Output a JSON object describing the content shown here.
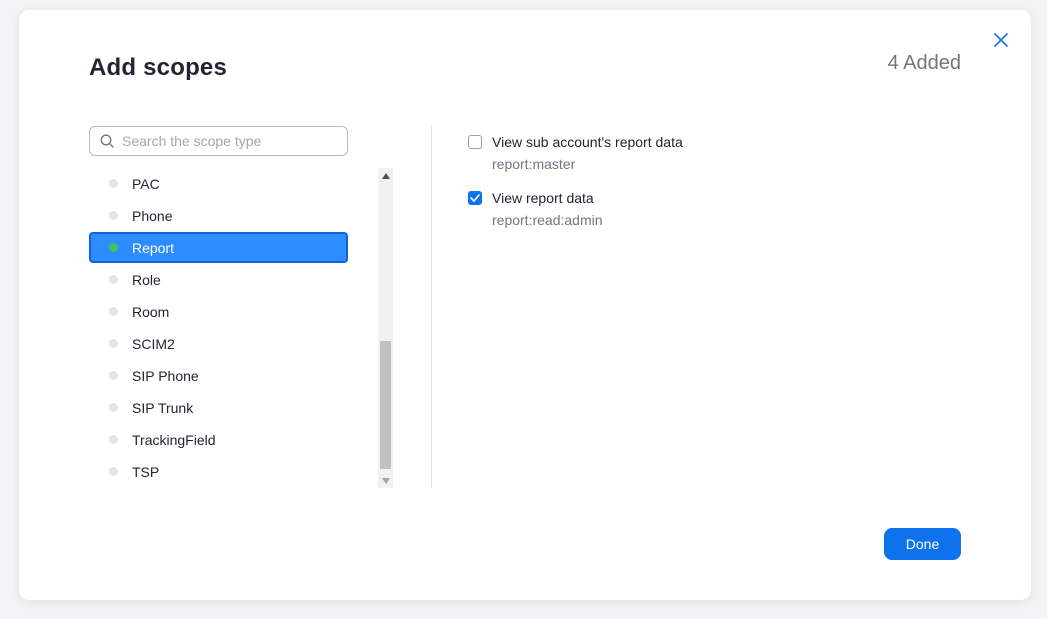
{
  "dialog": {
    "title": "Add scopes",
    "added_count": "4 Added",
    "done_label": "Done"
  },
  "search": {
    "placeholder": "Search the scope type",
    "value": ""
  },
  "scope_types": [
    {
      "label": "PAC"
    },
    {
      "label": "Phone"
    },
    {
      "label": "Report",
      "selected": true
    },
    {
      "label": "Role"
    },
    {
      "label": "Room"
    },
    {
      "label": "SCIM2"
    },
    {
      "label": "SIP Phone"
    },
    {
      "label": "SIP Trunk"
    },
    {
      "label": "TrackingField"
    },
    {
      "label": "TSP"
    }
  ],
  "scope_options": [
    {
      "label": "View sub account's report data",
      "scope": "report:master",
      "checked": false
    },
    {
      "label": "View report data",
      "scope": "report:read:admin",
      "checked": true
    }
  ],
  "colors": {
    "accent": "#0e72ed",
    "selected_bg": "#2d8cff",
    "active_dot": "#3fc35f"
  }
}
